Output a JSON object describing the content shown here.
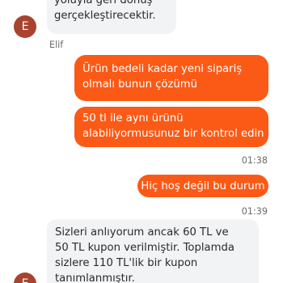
{
  "messages": [
    {
      "direction": "incoming",
      "lines": [
        "yoluyla geri dönüş",
        "gerçekleştirecektir."
      ]
    },
    {
      "direction": "outgoing",
      "lines": [
        "Ürün bedeli kadar yeni sipariş",
        "olmalı bunun çözümü"
      ]
    },
    {
      "direction": "outgoing",
      "lines": [
        "50 tl ile aynı ürünü",
        "alabiliyormusunuz bir kontrol edin"
      ]
    },
    {
      "direction": "outgoing",
      "lines": [
        "Hiç hoş değil bu durum"
      ]
    },
    {
      "direction": "incoming",
      "lines": [
        "Sizleri anlıyorum ancak 60 TL ve",
        "50 TL kupon verilmiştir. Toplamda",
        "sizlere 110 TL'lik bir kupon",
        "tanımlanmıştır."
      ]
    }
  ],
  "agent": {
    "avatar_letter": "E",
    "name": "Elif"
  },
  "timestamps": [
    "01:38",
    "01:39"
  ],
  "colors": {
    "outgoing_bubble": "#fb5a16",
    "incoming_bubble": "#f2f3f5",
    "avatar": "#a8432f"
  }
}
